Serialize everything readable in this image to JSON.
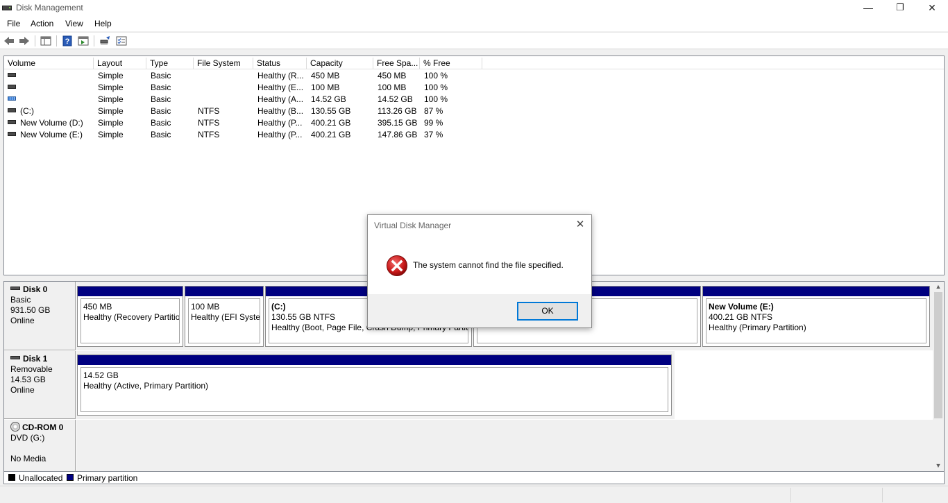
{
  "window": {
    "title": "Disk Management",
    "minimize_glyph": "—",
    "restore_glyph": "❐",
    "close_glyph": "✕"
  },
  "menu": [
    "File",
    "Action",
    "View",
    "Help"
  ],
  "toolbar_icons": [
    "back-arrow-icon",
    "forward-arrow-icon",
    "console-tree-icon",
    "help-icon",
    "properties-icon",
    "connect-disk-icon",
    "checklist-icon"
  ],
  "volume_list": {
    "columns": [
      "Volume",
      "Layout",
      "Type",
      "File System",
      "Status",
      "Capacity",
      "Free Spa...",
      "% Free"
    ],
    "rows": [
      {
        "volume": "",
        "icon": "gray",
        "layout": "Simple",
        "type": "Basic",
        "fs": "",
        "status": "Healthy (R...",
        "capacity": "450 MB",
        "free": "450 MB",
        "pct": "100 %"
      },
      {
        "volume": "",
        "icon": "gray",
        "layout": "Simple",
        "type": "Basic",
        "fs": "",
        "status": "Healthy (E...",
        "capacity": "100 MB",
        "free": "100 MB",
        "pct": "100 %"
      },
      {
        "volume": "",
        "icon": "blue",
        "layout": "Simple",
        "type": "Basic",
        "fs": "",
        "status": "Healthy (A...",
        "capacity": "14.52 GB",
        "free": "14.52 GB",
        "pct": "100 %"
      },
      {
        "volume": "(C:)",
        "icon": "gray",
        "layout": "Simple",
        "type": "Basic",
        "fs": "NTFS",
        "status": "Healthy (B...",
        "capacity": "130.55 GB",
        "free": "113.26 GB",
        "pct": "87 %"
      },
      {
        "volume": "New Volume (D:)",
        "icon": "gray",
        "layout": "Simple",
        "type": "Basic",
        "fs": "NTFS",
        "status": "Healthy (P...",
        "capacity": "400.21 GB",
        "free": "395.15 GB",
        "pct": "99 %"
      },
      {
        "volume": "New Volume (E:)",
        "icon": "gray",
        "layout": "Simple",
        "type": "Basic",
        "fs": "NTFS",
        "status": "Healthy (P...",
        "capacity": "400.21 GB",
        "free": "147.86 GB",
        "pct": "37 %"
      }
    ]
  },
  "disks": {
    "disk0": {
      "name": "Disk 0",
      "type": "Basic",
      "size": "931.50 GB",
      "state": "Online",
      "partitions": [
        {
          "title": "",
          "size": "450 MB",
          "status": "Healthy (Recovery Partition)"
        },
        {
          "title": "",
          "size": "100 MB",
          "status": "Healthy (EFI System Partition)"
        },
        {
          "title": "(C:)",
          "size": "130.55 GB NTFS",
          "status": "Healthy (Boot, Page File, Crash Dump, Primary Partition)"
        },
        {
          "title": "",
          "size": "",
          "status": "Healthy (Primary Partition)"
        },
        {
          "title": "New Volume  (E:)",
          "size": "400.21 GB NTFS",
          "status": "Healthy (Primary Partition)"
        }
      ]
    },
    "disk1": {
      "name": "Disk 1",
      "type": "Removable",
      "size": "14.53 GB",
      "state": "Online",
      "partitions": [
        {
          "title": "",
          "size": "14.52 GB",
          "status": "Healthy (Active, Primary Partition)"
        }
      ]
    },
    "cdrom0": {
      "name": "CD-ROM 0",
      "type": "DVD (G:)",
      "state": "No Media"
    }
  },
  "legend": {
    "unallocated": "Unallocated",
    "primary": "Primary partition",
    "unallocated_color": "#000000",
    "primary_color": "#000080"
  },
  "dialog": {
    "title": "Virtual Disk Manager",
    "message": "The system cannot find the file specified.",
    "ok": "OK",
    "close_glyph": "✕",
    "icon": "error-icon"
  }
}
